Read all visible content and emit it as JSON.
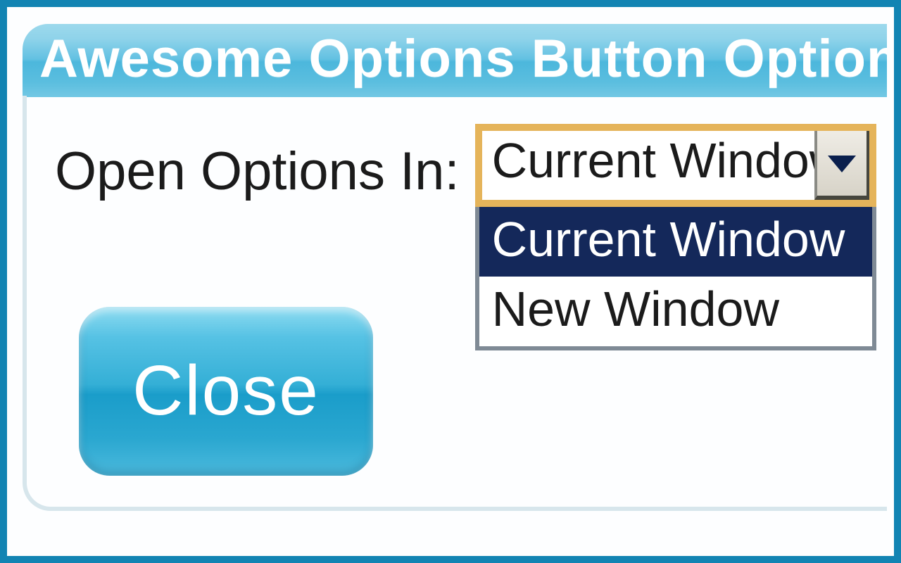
{
  "panel": {
    "title": "Awesome Options Button Options"
  },
  "form": {
    "open_options_label": "Open Options In:",
    "open_options_selected": "Current Window",
    "open_options_items": {
      "0": "Current Window",
      "1": "New Window"
    }
  },
  "buttons": {
    "close": "Close"
  }
}
